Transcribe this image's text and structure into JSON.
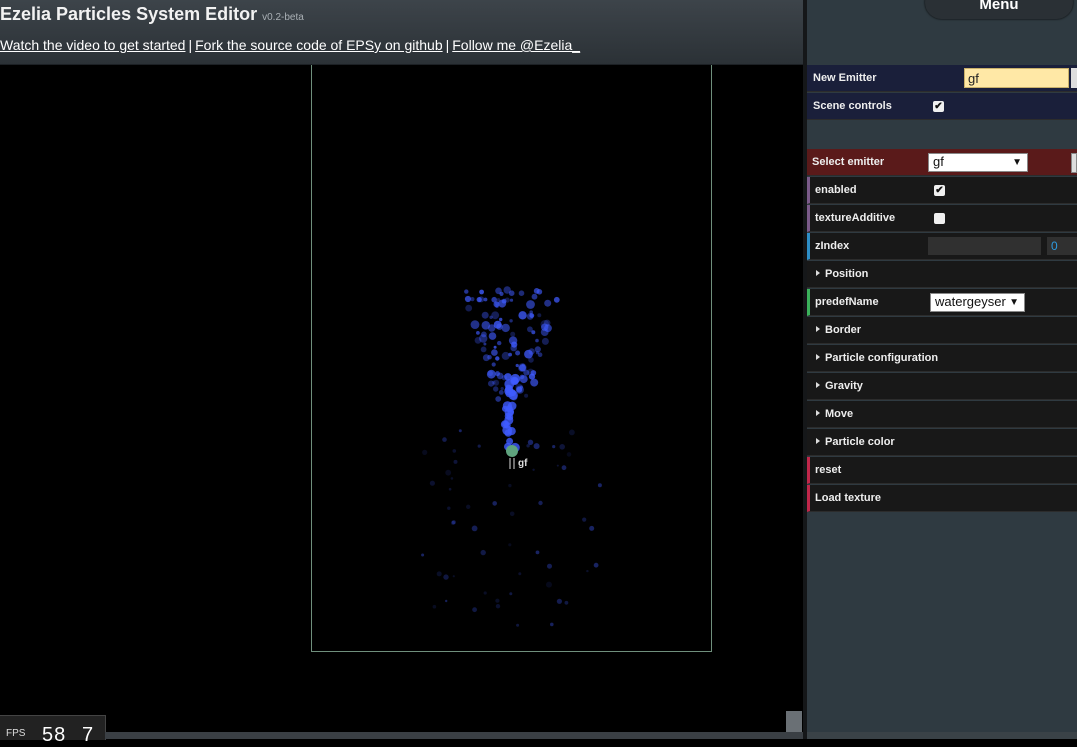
{
  "header": {
    "title": "Ezelia Particles System Editor",
    "version": "v0.2-beta",
    "links": [
      "Watch the video to get started",
      "Fork the source code of EPSy on github",
      "Follow me @Ezelia_"
    ],
    "separator": "|"
  },
  "canvas": {
    "emitter_label": "gf",
    "fps_label": "FPS",
    "fps_value": "58",
    "fps_value2": "7"
  },
  "panel": {
    "menu_label": "Menu",
    "new_emitter": {
      "label": "New Emitter",
      "value": "gf"
    },
    "scene_controls": {
      "label": "Scene controls",
      "checked": true
    },
    "select_emitter": {
      "label": "Select emitter",
      "value": "gf"
    },
    "enabled": {
      "label": "enabled",
      "checked": true
    },
    "texture_additive": {
      "label": "textureAdditive",
      "checked": false
    },
    "zindex": {
      "label": "zIndex",
      "value": "0"
    },
    "position_folder": "Position",
    "predef_name": {
      "label": "predefName",
      "value": "watergeyser"
    },
    "folders": [
      "Border",
      "Particle configuration",
      "Gravity",
      "Move",
      "Particle color"
    ],
    "reset_label": "reset",
    "load_texture_label": "Load texture"
  },
  "colors": {
    "particle": "#3f5bff",
    "emitter_handle": "#5fa37e",
    "frame": "#6f8f7c"
  }
}
